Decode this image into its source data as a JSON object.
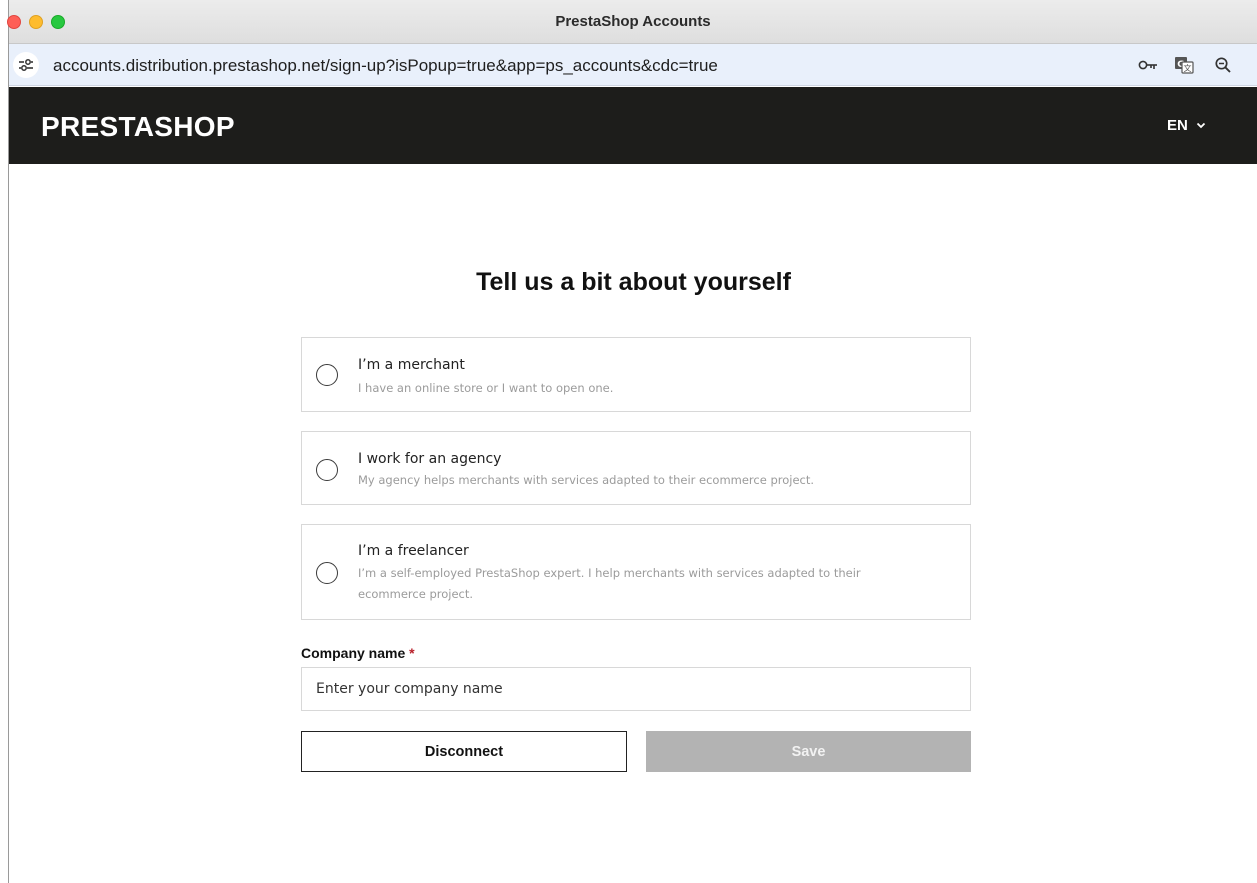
{
  "window": {
    "title": "PrestaShop Accounts"
  },
  "addressbar": {
    "url": "accounts.distribution.prestashop.net/sign-up?isPopup=true&app=ps_accounts&cdc=true"
  },
  "header": {
    "logo": "PRESTASHOP",
    "language": "EN"
  },
  "main": {
    "title": "Tell us a bit about yourself",
    "options": [
      {
        "title": "I’m a merchant",
        "description": "I have an online store or I want to open one."
      },
      {
        "title": "I work for an agency",
        "description": "My agency helps merchants with services adapted to their ecommerce project."
      },
      {
        "title": "I’m a freelancer",
        "description": "I’m a self-employed PrestaShop expert. I help merchants with services adapted to their ecommerce project."
      }
    ],
    "company_label": "Company name",
    "required_mark": "*",
    "company_placeholder": "Enter your company name",
    "company_value": "",
    "disconnect_label": "Disconnect",
    "save_label": "Save"
  },
  "colors": {
    "header_bg": "#1d1d1b",
    "required": "#b8202a",
    "save_disabled_bg": "#b3b3b3"
  },
  "icons": {
    "site_info": "site-settings-icon",
    "key": "key-icon",
    "translate": "translate-icon",
    "zoom": "zoom-icon",
    "language_caret": "chevron-down-icon"
  }
}
